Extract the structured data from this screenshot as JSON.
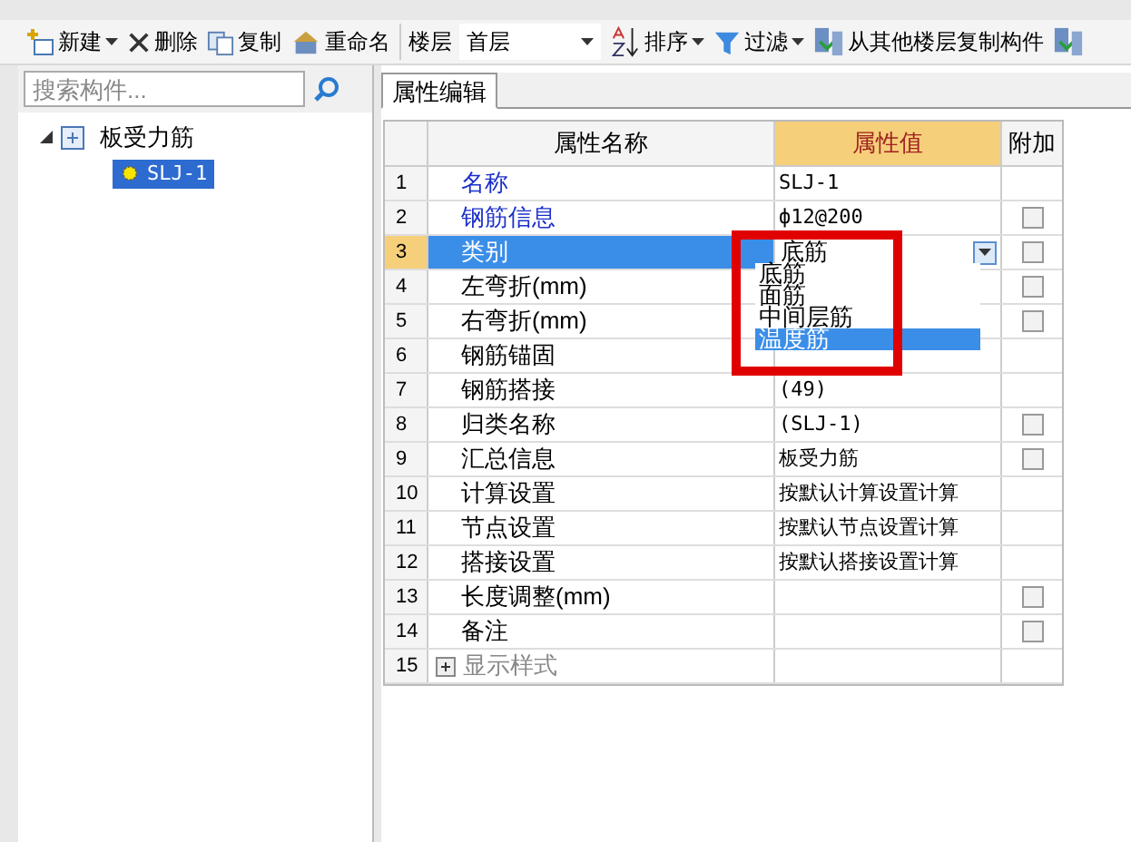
{
  "toolbar": {
    "items": [
      {
        "kind": "button",
        "label": "新建",
        "caret": true
      },
      {
        "kind": "button",
        "label": "删除",
        "caret": false
      },
      {
        "kind": "button",
        "label": "复制",
        "caret": false
      },
      {
        "kind": "button",
        "label": "重命名",
        "caret": false
      },
      {
        "kind": "select",
        "label": "楼层",
        "value": "首层"
      },
      {
        "kind": "button",
        "label": "排序",
        "caret": true
      },
      {
        "kind": "button",
        "label": "过滤",
        "caret": true
      },
      {
        "kind": "button",
        "label": "从其他楼层复制构件",
        "caret": false
      },
      {
        "kind": "icon"
      }
    ]
  },
  "search": {
    "placeholder": "搜索构件..."
  },
  "tree": [
    {
      "label": "板受力筋",
      "expanded": true,
      "selected": false,
      "children": [
        {
          "label": "SLJ-1",
          "selected": true
        }
      ]
    }
  ],
  "tab": {
    "label": "属性编辑"
  },
  "table": {
    "columns": [
      "属性名称",
      "属性值",
      "附加"
    ],
    "rows": [
      {
        "num": "1",
        "name": "名称",
        "value": "SLJ-1",
        "link": true,
        "selected": false
      },
      {
        "num": "2",
        "name": "钢筋信息",
        "value": "ф12@200",
        "link": true,
        "selected": false,
        "checked": false
      },
      {
        "num": "3",
        "name": "类别",
        "value": "底筋",
        "selected": true,
        "checked": false,
        "dropdown": true
      },
      {
        "num": "4",
        "name": "左弯折(mm)",
        "value": "",
        "link": false,
        "selected": false,
        "checked": false
      },
      {
        "num": "5",
        "name": "右弯折(mm)",
        "value": "",
        "link": false,
        "selected": false,
        "checked": false
      },
      {
        "num": "6",
        "name": "钢筋锚固",
        "value": "",
        "link": false,
        "selected": false
      },
      {
        "num": "7",
        "name": "钢筋搭接",
        "value": "(49)",
        "link": false,
        "selected": false
      },
      {
        "num": "8",
        "name": "归类名称",
        "value": "(SLJ-1)",
        "link": false,
        "selected": false,
        "checked": false
      },
      {
        "num": "9",
        "name": "汇总信息",
        "value": "板受力筋",
        "link": false,
        "selected": false,
        "checked": false
      },
      {
        "num": "10",
        "name": "计算设置",
        "value": "按默认计算设置计算",
        "link": false,
        "selected": false
      },
      {
        "num": "11",
        "name": "节点设置",
        "value": "按默认节点设置计算",
        "link": false,
        "selected": false
      },
      {
        "num": "12",
        "name": "搭接设置",
        "value": "按默认搭接设置计算",
        "link": false,
        "selected": false
      },
      {
        "num": "13",
        "name": "长度调整(mm)",
        "value": "",
        "link": false,
        "selected": false,
        "checked": false
      },
      {
        "num": "14",
        "name": "备注",
        "value": "",
        "link": false,
        "selected": false,
        "checked": false
      },
      {
        "num": "15",
        "name": "显示样式",
        "value": "",
        "link": false,
        "selected": false,
        "kind": "group",
        "expanded": false
      }
    ]
  },
  "dropdown": {
    "options": [
      {
        "label": "底筋",
        "selected": false
      },
      {
        "label": "面筋",
        "selected": false
      },
      {
        "label": "中间层筋",
        "selected": false
      },
      {
        "label": "温度筋",
        "selected": true
      }
    ]
  }
}
